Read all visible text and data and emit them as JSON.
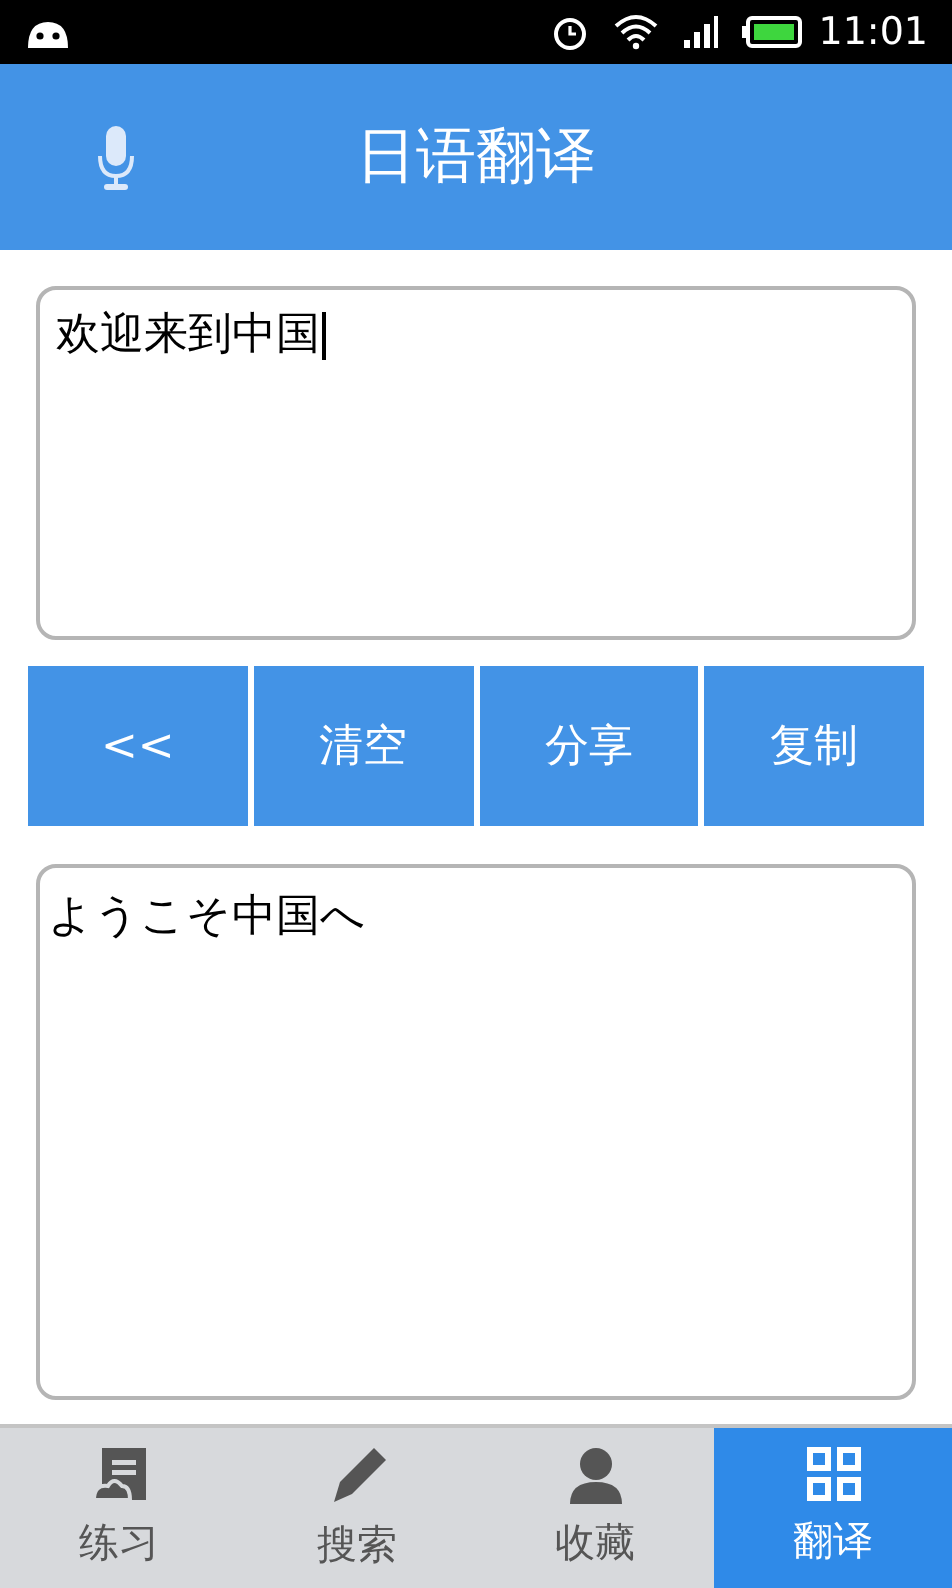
{
  "status_bar": {
    "time": "11:01"
  },
  "header": {
    "title": "日语翻译"
  },
  "source_field": {
    "value": "欢迎来到中国",
    "focused": true
  },
  "actions": [
    {
      "label": "<<"
    },
    {
      "label": "清空"
    },
    {
      "label": "分享"
    },
    {
      "label": "复制"
    }
  ],
  "result_field": {
    "value": "ようこそ中国へ"
  },
  "tabs": [
    {
      "label": "练习",
      "kind": "note",
      "selected": false
    },
    {
      "label": "搜索",
      "kind": "pencil",
      "selected": false
    },
    {
      "label": "收藏",
      "kind": "person",
      "selected": false
    },
    {
      "label": "翻译",
      "kind": "grid",
      "selected": true
    }
  ]
}
